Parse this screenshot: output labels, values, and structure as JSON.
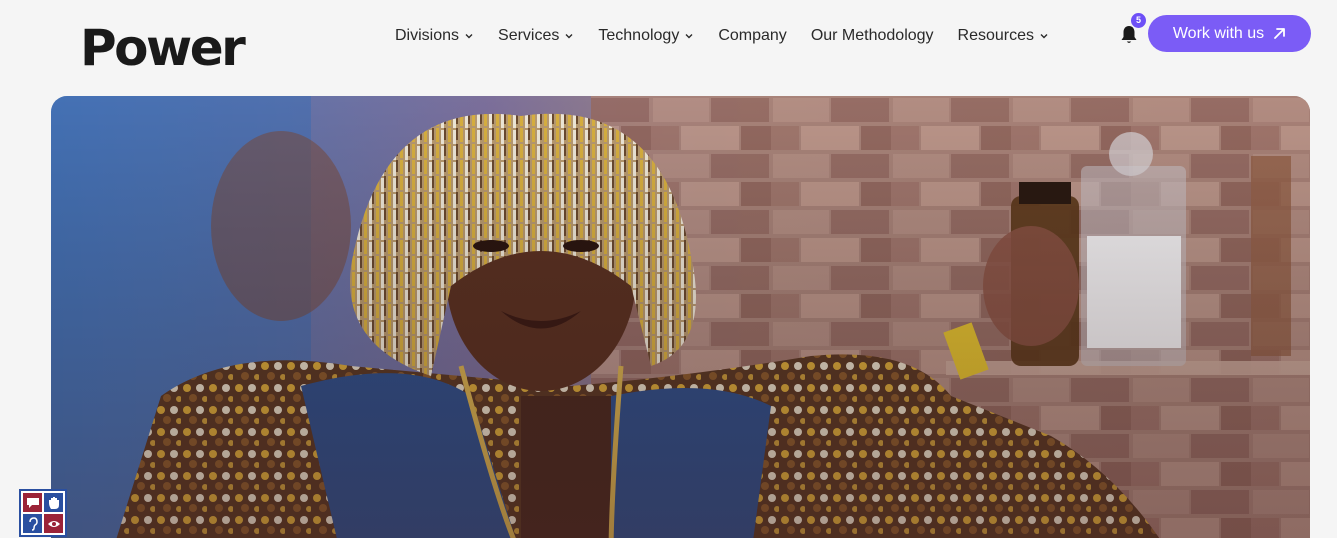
{
  "header": {
    "logo": "Power",
    "nav": [
      {
        "label": "Divisions",
        "has_dropdown": true
      },
      {
        "label": "Services",
        "has_dropdown": true
      },
      {
        "label": "Technology",
        "has_dropdown": true
      },
      {
        "label": "Company",
        "has_dropdown": false
      },
      {
        "label": "Our Methodology",
        "has_dropdown": false
      },
      {
        "label": "Resources",
        "has_dropdown": true
      }
    ],
    "notifications_count": "5",
    "cta_label": "Work with us"
  },
  "hero": {
    "icon": "hero-video-frame"
  },
  "accessibility_widget": {
    "icons": [
      "speech-bubble-icon",
      "hand-icon",
      "ear-icon",
      "eye-icon"
    ]
  },
  "colors": {
    "accent": "#7b5cf6",
    "badge": "#6d4ff7",
    "a11y_red": "#9b2338",
    "a11y_blue": "#2a4fa0"
  }
}
